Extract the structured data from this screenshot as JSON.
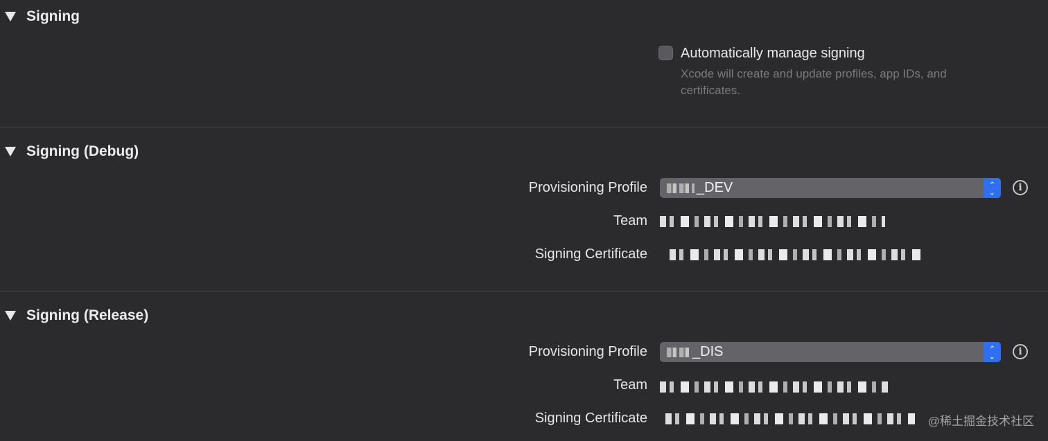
{
  "signing": {
    "title": "Signing",
    "auto_manage_label": "Automatically manage signing",
    "auto_manage_checked": false,
    "auto_manage_description": "Xcode will create and update profiles, app IDs, and certificates."
  },
  "signing_debug": {
    "title": "Signing (Debug)",
    "provisioning_profile_label": "Provisioning Profile",
    "provisioning_profile_value": "_DEV",
    "team_label": "Team",
    "signing_certificate_label": "Signing Certificate"
  },
  "signing_release": {
    "title": "Signing (Release)",
    "provisioning_profile_label": "Provisioning Profile",
    "provisioning_profile_value": "_DIS",
    "team_label": "Team",
    "signing_certificate_label": "Signing Certificate"
  },
  "icons": {
    "disclosure": "disclosure-triangle-down-icon",
    "info": "info-circle-icon",
    "stepper": "chevron-up-down-icon"
  },
  "colors": {
    "background": "#2b2b2d",
    "accent": "#2f6ff2",
    "popup": "#646468"
  },
  "watermark": "@稀土掘金技术社区"
}
